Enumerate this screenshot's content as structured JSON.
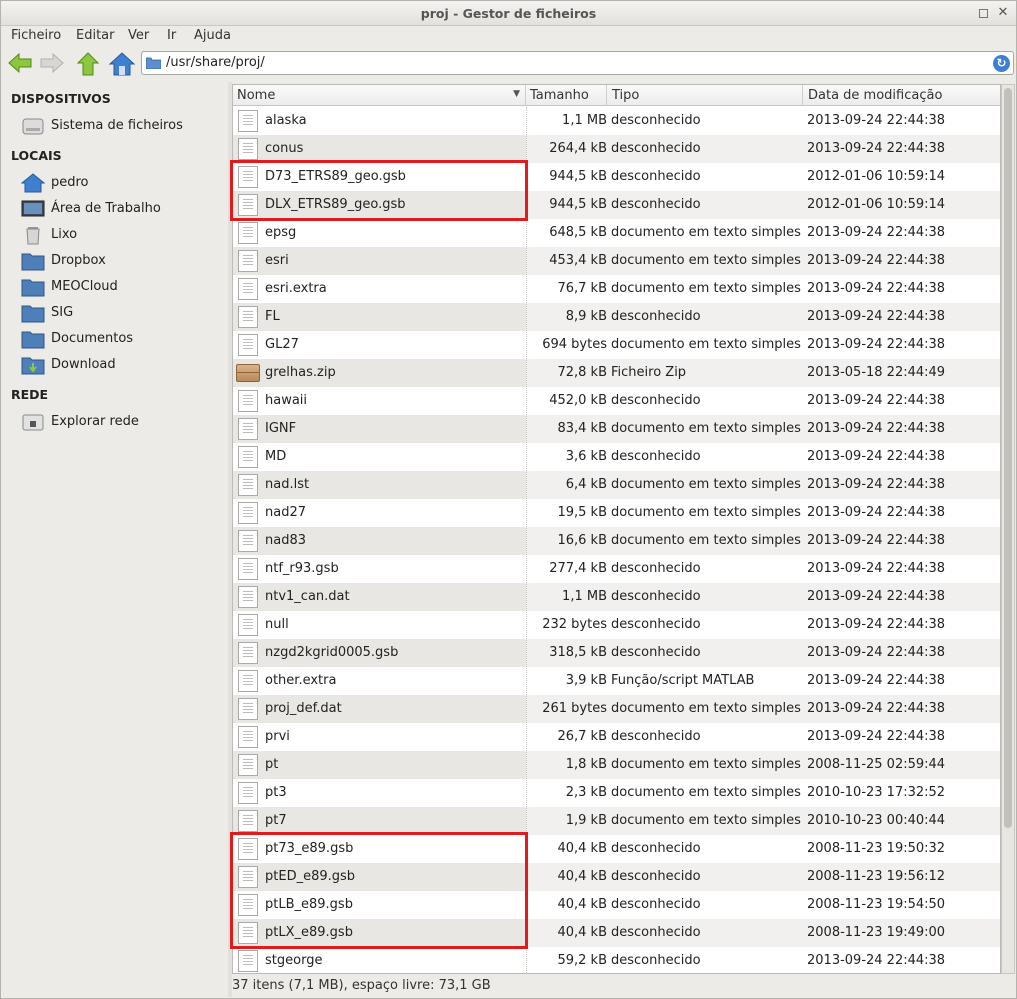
{
  "window": {
    "title": "proj - Gestor de ficheiros"
  },
  "menu": [
    "Ficheiro",
    "Editar",
    "Ver",
    "Ir",
    "Ajuda"
  ],
  "toolbar": {
    "path": "/usr/share/proj/"
  },
  "sidebar": {
    "devices_header": "DISPOSITIVOS",
    "devices": [
      {
        "label": "Sistema de ficheiros",
        "icon": "drive-icon"
      }
    ],
    "places_header": "LOCAIS",
    "places": [
      {
        "label": "pedro",
        "icon": "home-icon"
      },
      {
        "label": "Área de Trabalho",
        "icon": "desktop-icon"
      },
      {
        "label": "Lixo",
        "icon": "trash-icon"
      },
      {
        "label": "Dropbox",
        "icon": "folder-icon"
      },
      {
        "label": "MEOCloud",
        "icon": "folder-icon"
      },
      {
        "label": "SIG",
        "icon": "folder-icon"
      },
      {
        "label": "Documentos",
        "icon": "folder-icon"
      },
      {
        "label": "Download",
        "icon": "download-folder-icon"
      }
    ],
    "network_header": "REDE",
    "network": [
      {
        "label": "Explorar rede",
        "icon": "network-icon"
      }
    ]
  },
  "columns": {
    "name": "Nome",
    "size": "Tamanho",
    "type": "Tipo",
    "date": "Data de modificação"
  },
  "files": [
    {
      "name": "alaska",
      "size": "1,1 MB",
      "type": "desconhecido",
      "date": "2013-09-24 22:44:38"
    },
    {
      "name": "conus",
      "size": "264,4 kB",
      "type": "desconhecido",
      "date": "2013-09-24 22:44:38"
    },
    {
      "name": "D73_ETRS89_geo.gsb",
      "size": "944,5 kB",
      "type": "desconhecido",
      "date": "2012-01-06 10:59:14"
    },
    {
      "name": "DLX_ETRS89_geo.gsb",
      "size": "944,5 kB",
      "type": "desconhecido",
      "date": "2012-01-06 10:59:14"
    },
    {
      "name": "epsg",
      "size": "648,5 kB",
      "type": "documento em texto simples",
      "date": "2013-09-24 22:44:38"
    },
    {
      "name": "esri",
      "size": "453,4 kB",
      "type": "documento em texto simples",
      "date": "2013-09-24 22:44:38"
    },
    {
      "name": "esri.extra",
      "size": "76,7 kB",
      "type": "documento em texto simples",
      "date": "2013-09-24 22:44:38"
    },
    {
      "name": "FL",
      "size": "8,9 kB",
      "type": "desconhecido",
      "date": "2013-09-24 22:44:38"
    },
    {
      "name": "GL27",
      "size": "694 bytes",
      "type": "documento em texto simples",
      "date": "2013-09-24 22:44:38"
    },
    {
      "name": "grelhas.zip",
      "size": "72,8 kB",
      "type": "Ficheiro Zip",
      "date": "2013-05-18 22:44:49",
      "zip": true
    },
    {
      "name": "hawaii",
      "size": "452,0 kB",
      "type": "desconhecido",
      "date": "2013-09-24 22:44:38"
    },
    {
      "name": "IGNF",
      "size": "83,4 kB",
      "type": "documento em texto simples",
      "date": "2013-09-24 22:44:38"
    },
    {
      "name": "MD",
      "size": "3,6 kB",
      "type": "desconhecido",
      "date": "2013-09-24 22:44:38"
    },
    {
      "name": "nad.lst",
      "size": "6,4 kB",
      "type": "documento em texto simples",
      "date": "2013-09-24 22:44:38"
    },
    {
      "name": "nad27",
      "size": "19,5 kB",
      "type": "documento em texto simples",
      "date": "2013-09-24 22:44:38"
    },
    {
      "name": "nad83",
      "size": "16,6 kB",
      "type": "documento em texto simples",
      "date": "2013-09-24 22:44:38"
    },
    {
      "name": "ntf_r93.gsb",
      "size": "277,4 kB",
      "type": "desconhecido",
      "date": "2013-09-24 22:44:38"
    },
    {
      "name": "ntv1_can.dat",
      "size": "1,1 MB",
      "type": "desconhecido",
      "date": "2013-09-24 22:44:38"
    },
    {
      "name": "null",
      "size": "232 bytes",
      "type": "desconhecido",
      "date": "2013-09-24 22:44:38"
    },
    {
      "name": "nzgd2kgrid0005.gsb",
      "size": "318,5 kB",
      "type": "desconhecido",
      "date": "2013-09-24 22:44:38"
    },
    {
      "name": "other.extra",
      "size": "3,9 kB",
      "type": "Função/script MATLAB",
      "date": "2013-09-24 22:44:38"
    },
    {
      "name": "proj_def.dat",
      "size": "261 bytes",
      "type": "documento em texto simples",
      "date": "2013-09-24 22:44:38"
    },
    {
      "name": "prvi",
      "size": "26,7 kB",
      "type": "desconhecido",
      "date": "2013-09-24 22:44:38"
    },
    {
      "name": "pt",
      "size": "1,8 kB",
      "type": "documento em texto simples",
      "date": "2008-11-25 02:59:44"
    },
    {
      "name": "pt3",
      "size": "2,3 kB",
      "type": "documento em texto simples",
      "date": "2010-10-23 17:32:52"
    },
    {
      "name": "pt7",
      "size": "1,9 kB",
      "type": "documento em texto simples",
      "date": "2010-10-23 00:40:44"
    },
    {
      "name": "pt73_e89.gsb",
      "size": "40,4 kB",
      "type": "desconhecido",
      "date": "2008-11-23 19:50:32"
    },
    {
      "name": "ptED_e89.gsb",
      "size": "40,4 kB",
      "type": "desconhecido",
      "date": "2008-11-23 19:56:12"
    },
    {
      "name": "ptLB_e89.gsb",
      "size": "40,4 kB",
      "type": "desconhecido",
      "date": "2008-11-23 19:54:50"
    },
    {
      "name": "ptLX_e89.gsb",
      "size": "40,4 kB",
      "type": "desconhecido",
      "date": "2008-11-23 19:49:00"
    },
    {
      "name": "stgeorge",
      "size": "59,2 kB",
      "type": "desconhecido",
      "date": "2013-09-24 22:44:38"
    }
  ],
  "highlights": [
    {
      "first": "D73_ETRS89_geo.gsb",
      "last": "DLX_ETRS89_geo.gsb",
      "color": "#e01b1b"
    },
    {
      "first": "pt73_e89.gsb",
      "last": "ptLX_e89.gsb",
      "color": "#e01b1b"
    }
  ],
  "status": "37 itens (7,1 MB), espaço livre: 73,1 GB"
}
